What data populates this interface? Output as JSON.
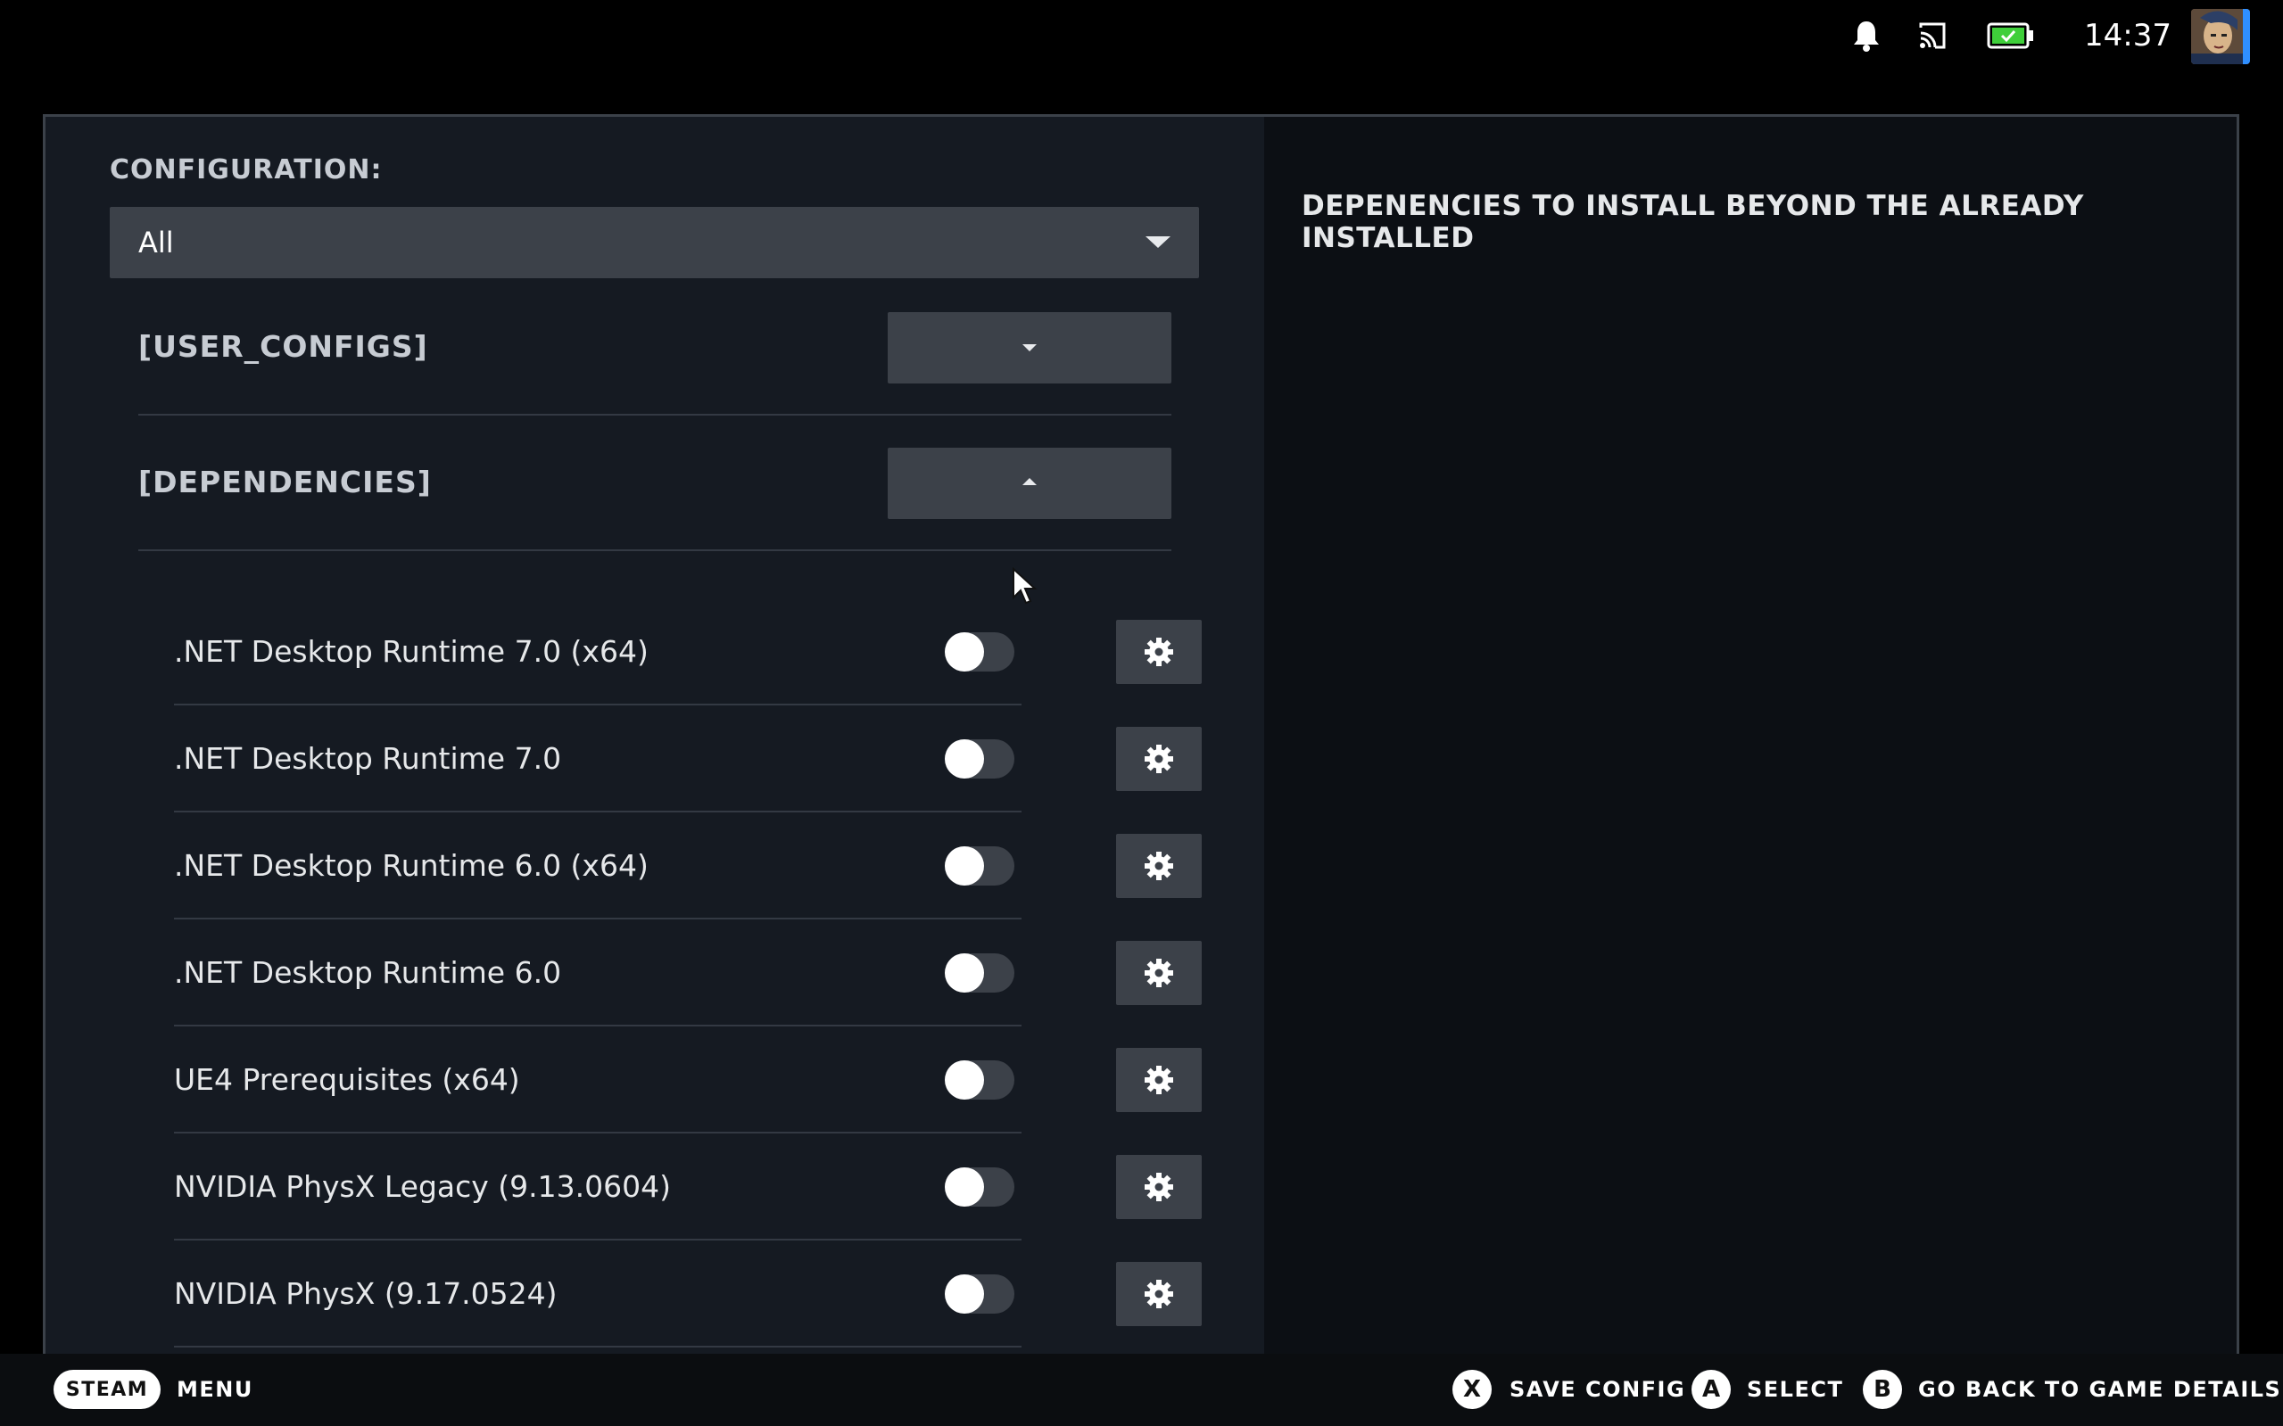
{
  "status_bar": {
    "clock": "14:37",
    "icons": [
      "bell-icon",
      "cast-icon",
      "battery-charging-icon"
    ],
    "battery_color": "#3fcf3a"
  },
  "configuration": {
    "label": "CONFIGURATION:",
    "selected": "All"
  },
  "sections": {
    "user_configs": {
      "label": "[USER_CONFIGS]",
      "state": "collapsed"
    },
    "dependencies": {
      "label": "[DEPENDENCIES]",
      "state": "expanded"
    }
  },
  "dependencies": [
    {
      "label": ".NET Desktop Runtime 7.0 (x64)",
      "enabled": false
    },
    {
      "label": ".NET Desktop Runtime 7.0",
      "enabled": false
    },
    {
      "label": ".NET Desktop Runtime 6.0 (x64)",
      "enabled": false
    },
    {
      "label": ".NET Desktop Runtime 6.0",
      "enabled": false
    },
    {
      "label": "UE4 Prerequisites (x64)",
      "enabled": false
    },
    {
      "label": "NVIDIA PhysX Legacy (9.13.0604)",
      "enabled": false
    },
    {
      "label": "NVIDIA PhysX (9.17.0524)",
      "enabled": false
    }
  ],
  "right_pane": {
    "title": "DEPENENCIES TO INSTALL BEYOND THE ALREADY INSTALLED"
  },
  "bottom_bar": {
    "steam": "STEAM",
    "menu": "MENU",
    "actions": [
      {
        "glyph": "X",
        "label": "SAVE CONFIG"
      },
      {
        "glyph": "A",
        "label": "SELECT"
      },
      {
        "glyph": "B",
        "label": "GO BACK TO GAME DETAILS"
      }
    ]
  }
}
